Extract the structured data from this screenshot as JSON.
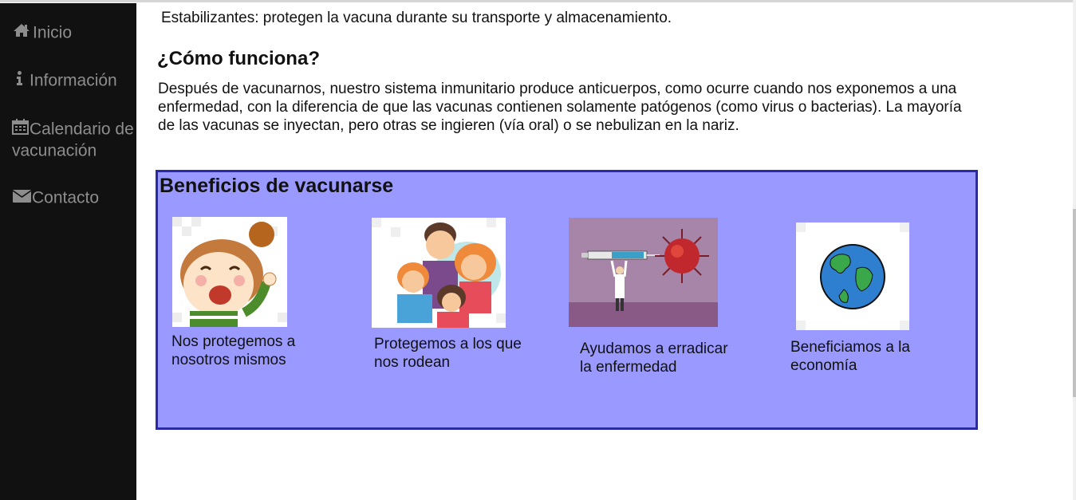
{
  "nav": {
    "items": [
      {
        "label": "Inicio",
        "icon": "home-icon"
      },
      {
        "label": "Información",
        "icon": "info-icon"
      },
      {
        "label": "Calendario de vacunación",
        "icon": "calendar-icon"
      },
      {
        "label": "Contacto",
        "icon": "envelope-icon"
      }
    ]
  },
  "content": {
    "stabilizers_text": "Estabilizantes: protegen la vacuna durante su transporte y almacenamiento.",
    "how_title": "¿Cómo funciona?",
    "how_text": "Después de vacunarnos, nuestro sistema inmunitario produce anticuerpos, como ocurre cuando nos exponemos a una enfermedad, con la diferencia de que las vacunas contienen solamente patógenos (como virus o bacterias). La mayoría de las vacunas se inyectan, pero otras se ingieren (vía oral) o se nebulizan en la nariz."
  },
  "benefits": {
    "title": "Beneficios de vacunarse",
    "background": "#9999ff",
    "border": "#2a2aa6",
    "cards": [
      {
        "text": "Nos protegemos a nosotros mismos",
        "image": "happy-girl-image"
      },
      {
        "text": "Protegemos a los que nos rodean",
        "image": "family-image"
      },
      {
        "text": "Ayudamos a erradicar la enfermedad",
        "image": "syringe-virus-image"
      },
      {
        "text": "Beneficiamos a la economía",
        "image": "earth-globe-image"
      }
    ]
  },
  "colors": {
    "sidebar": "#111111",
    "nav_text": "#8d8d8d"
  }
}
